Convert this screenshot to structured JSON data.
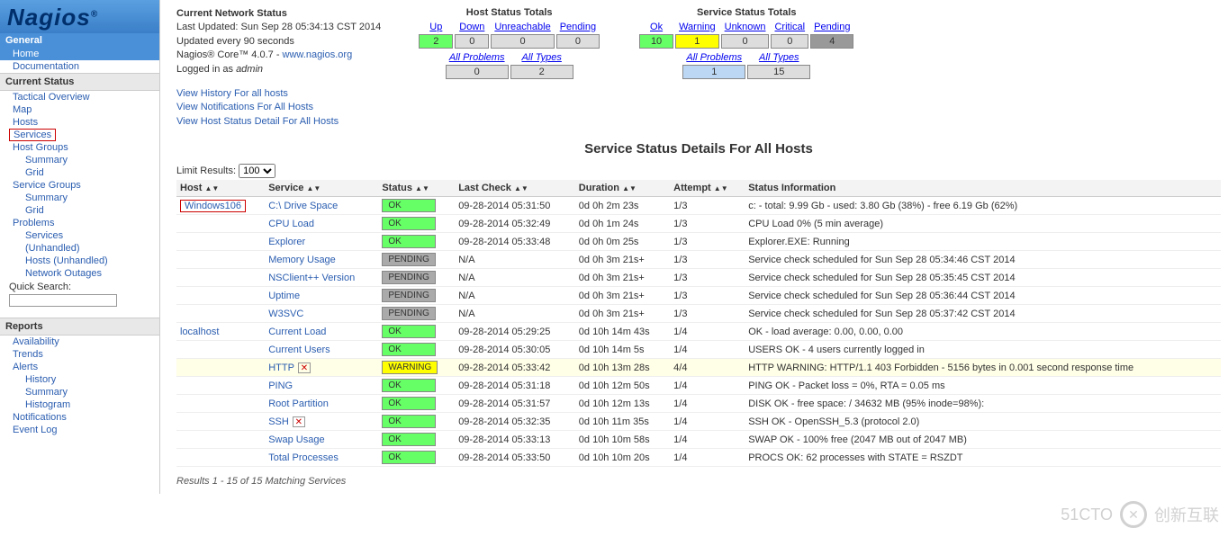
{
  "logo": "Nagios",
  "sidebar": {
    "general_title": "General",
    "home": "Home",
    "documentation": "Documentation",
    "current_status_title": "Current Status",
    "tactical": "Tactical Overview",
    "map": "Map",
    "hosts": "Hosts",
    "services": "Services",
    "host_groups": "Host Groups",
    "hg_summary": "Summary",
    "hg_grid": "Grid",
    "service_groups": "Service Groups",
    "sg_summary": "Summary",
    "sg_grid": "Grid",
    "problems": "Problems",
    "p_services": "Services",
    "p_unhandled": "(Unhandled)",
    "p_hosts": "Hosts",
    "p_unhandled2": "(Unhandled)",
    "p_outages": "Network Outages",
    "quick_label": "Quick Search:",
    "reports_title": "Reports",
    "availability": "Availability",
    "trends": "Trends",
    "alerts": "Alerts",
    "a_history": "History",
    "a_summary": "Summary",
    "a_histogram": "Histogram",
    "notifications": "Notifications",
    "event_log": "Event Log"
  },
  "status": {
    "title": "Current Network Status",
    "last_updated": "Last Updated: Sun Sep 28 05:34:13 CST 2014",
    "updated_every": "Updated every 90 seconds",
    "version_pre": "Nagios® Core™ 4.0.7 - ",
    "nagios_link": "www.nagios.org",
    "logged_pre": "Logged in as ",
    "user": "admin",
    "link1": "View History For all hosts",
    "link2": "View Notifications For All Hosts",
    "link3": "View Host Status Detail For All Hosts"
  },
  "host_totals": {
    "title": "Host Status Totals",
    "h_up": "Up",
    "h_down": "Down",
    "h_unreach": "Unreachable",
    "h_pending": "Pending",
    "v_up": "2",
    "v_down": "0",
    "v_unreach": "0",
    "v_pending": "0",
    "ap": "All Problems",
    "at": "All Types",
    "v_ap": "0",
    "v_at": "2"
  },
  "svc_totals": {
    "title": "Service Status Totals",
    "h_ok": "Ok",
    "h_warn": "Warning",
    "h_unk": "Unknown",
    "h_crit": "Critical",
    "h_pend": "Pending",
    "v_ok": "10",
    "v_warn": "1",
    "v_unk": "0",
    "v_crit": "0",
    "v_pend": "4",
    "ap": "All Problems",
    "at": "All Types",
    "v_ap": "1",
    "v_at": "15"
  },
  "page_title": "Service Status Details For All Hosts",
  "limit_label": "Limit Results:",
  "limit_value": "100",
  "headers": {
    "host": "Host",
    "service": "Service",
    "status": "Status",
    "last": "Last Check",
    "duration": "Duration",
    "attempt": "Attempt",
    "info": "Status Information"
  },
  "rows": [
    {
      "host": "Windows106",
      "boxed": true,
      "service": "C:\\ Drive Space",
      "status": "OK",
      "st": "ok",
      "last": "09-28-2014 05:31:50",
      "dur": "0d 0h 2m 23s",
      "att": "1/3",
      "info": "c: - total: 9.99 Gb - used: 3.80 Gb (38%) - free 6.19 Gb (62%)"
    },
    {
      "host": "",
      "service": "CPU Load",
      "status": "OK",
      "st": "ok",
      "last": "09-28-2014 05:32:49",
      "dur": "0d 0h 1m 24s",
      "att": "1/3",
      "info": "CPU Load 0% (5 min average)"
    },
    {
      "host": "",
      "service": "Explorer",
      "status": "OK",
      "st": "ok",
      "last": "09-28-2014 05:33:48",
      "dur": "0d 0h 0m 25s",
      "att": "1/3",
      "info": "Explorer.EXE: Running"
    },
    {
      "host": "",
      "service": "Memory Usage",
      "status": "PENDING",
      "st": "pending",
      "last": "N/A",
      "dur": "0d 0h 3m 21s+",
      "att": "1/3",
      "info": "Service check scheduled for Sun Sep 28 05:34:46 CST 2014"
    },
    {
      "host": "",
      "service": "NSClient++ Version",
      "status": "PENDING",
      "st": "pending",
      "last": "N/A",
      "dur": "0d 0h 3m 21s+",
      "att": "1/3",
      "info": "Service check scheduled for Sun Sep 28 05:35:45 CST 2014"
    },
    {
      "host": "",
      "service": "Uptime",
      "status": "PENDING",
      "st": "pending",
      "last": "N/A",
      "dur": "0d 0h 3m 21s+",
      "att": "1/3",
      "info": "Service check scheduled for Sun Sep 28 05:36:44 CST 2014"
    },
    {
      "host": "",
      "service": "W3SVC",
      "status": "PENDING",
      "st": "pending",
      "last": "N/A",
      "dur": "0d 0h 3m 21s+",
      "att": "1/3",
      "info": "Service check scheduled for Sun Sep 28 05:37:42 CST 2014"
    },
    {
      "host": "localhost",
      "service": "Current Load",
      "status": "OK",
      "st": "ok",
      "last": "09-28-2014 05:29:25",
      "dur": "0d 10h 14m 43s",
      "att": "1/4",
      "info": "OK - load average: 0.00, 0.00, 0.00"
    },
    {
      "host": "",
      "service": "Current Users",
      "status": "OK",
      "st": "ok",
      "last": "09-28-2014 05:30:05",
      "dur": "0d 10h 14m 5s",
      "att": "1/4",
      "info": "USERS OK - 4 users currently logged in"
    },
    {
      "host": "",
      "service": "HTTP",
      "status": "WARNING",
      "st": "warning",
      "warn": true,
      "icon": true,
      "last": "09-28-2014 05:33:42",
      "dur": "0d 10h 13m 28s",
      "att": "4/4",
      "info": "HTTP WARNING: HTTP/1.1 403 Forbidden - 5156 bytes in 0.001 second response time"
    },
    {
      "host": "",
      "service": "PING",
      "status": "OK",
      "st": "ok",
      "last": "09-28-2014 05:31:18",
      "dur": "0d 10h 12m 50s",
      "att": "1/4",
      "info": "PING OK - Packet loss = 0%, RTA = 0.05 ms"
    },
    {
      "host": "",
      "service": "Root Partition",
      "status": "OK",
      "st": "ok",
      "last": "09-28-2014 05:31:57",
      "dur": "0d 10h 12m 13s",
      "att": "1/4",
      "info": "DISK OK - free space: / 34632 MB (95% inode=98%):"
    },
    {
      "host": "",
      "service": "SSH",
      "status": "OK",
      "st": "ok",
      "icon": true,
      "last": "09-28-2014 05:32:35",
      "dur": "0d 10h 11m 35s",
      "att": "1/4",
      "info": "SSH OK - OpenSSH_5.3 (protocol 2.0)"
    },
    {
      "host": "",
      "service": "Swap Usage",
      "status": "OK",
      "st": "ok",
      "last": "09-28-2014 05:33:13",
      "dur": "0d 10h 10m 58s",
      "att": "1/4",
      "info": "SWAP OK - 100% free (2047 MB out of 2047 MB)"
    },
    {
      "host": "",
      "service": "Total Processes",
      "status": "OK",
      "st": "ok",
      "last": "09-28-2014 05:33:50",
      "dur": "0d 10h 10m 20s",
      "att": "1/4",
      "info": "PROCS OK: 62 processes with STATE = RSZDT"
    }
  ],
  "results_footer": "Results 1 - 15 of 15 Matching Services",
  "watermark": "创新互联"
}
